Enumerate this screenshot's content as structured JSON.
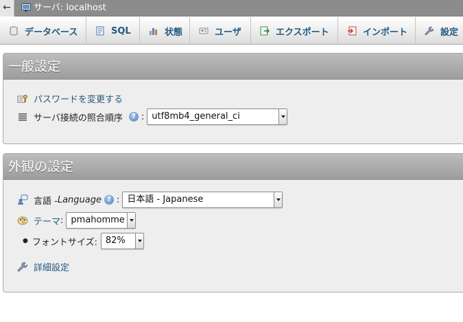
{
  "topbar": {
    "back_icon": "left-arrow",
    "server_icon": "server-icon",
    "server_label": "サーバ: localhost"
  },
  "tabs": [
    {
      "label": "データベース",
      "icon": "database-icon"
    },
    {
      "label": "SQL",
      "icon": "sql-icon"
    },
    {
      "label": "状態",
      "icon": "status-icon"
    },
    {
      "label": "ユーザ",
      "icon": "users-icon"
    },
    {
      "label": "エクスポート",
      "icon": "export-icon"
    },
    {
      "label": "インポート",
      "icon": "import-icon"
    },
    {
      "label": "設定",
      "icon": "wrench-icon"
    }
  ],
  "general": {
    "title": "一般設定",
    "change_password": "パスワードを変更する",
    "collation_label": "サーバ接続の照合順序",
    "collation_colon": ":",
    "collation_value": "utf8mb4_general_ci"
  },
  "appearance": {
    "title": "外観の設定",
    "language_label": "言語 - ",
    "language_label_italic": "Language",
    "language_colon": ":",
    "language_value": "日本語 - Japanese",
    "theme_label": "テーマ",
    "theme_colon": ":",
    "theme_value": "pmahomme",
    "fontsize_label": "フォントサイズ:",
    "fontsize_value": "82%",
    "more_settings": "詳細設定"
  },
  "colors": {
    "link": "#235a81",
    "panel_bg": "#eeeeee",
    "panel_header": "#9c9c9c",
    "topbar": "#8c8c8c"
  }
}
